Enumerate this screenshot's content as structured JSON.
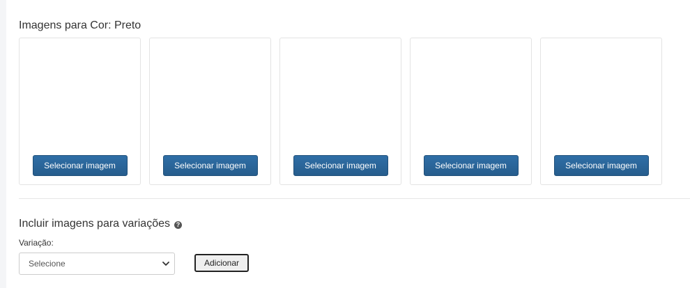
{
  "color_images": {
    "title": "Imagens para Cor: Preto",
    "slots": [
      {
        "button_label": "Selecionar imagem"
      },
      {
        "button_label": "Selecionar imagem"
      },
      {
        "button_label": "Selecionar imagem"
      },
      {
        "button_label": "Selecionar imagem"
      },
      {
        "button_label": "Selecionar imagem"
      }
    ]
  },
  "variations": {
    "title": "Incluir imagens para variações",
    "help_icon": "question-circle-icon",
    "variation_label": "Variação:",
    "select_value": "Selecione",
    "add_button_label": "Adicionar"
  },
  "colors": {
    "primary_button": "#2f6ea6",
    "text": "#333333",
    "border": "#e3e3e3"
  }
}
